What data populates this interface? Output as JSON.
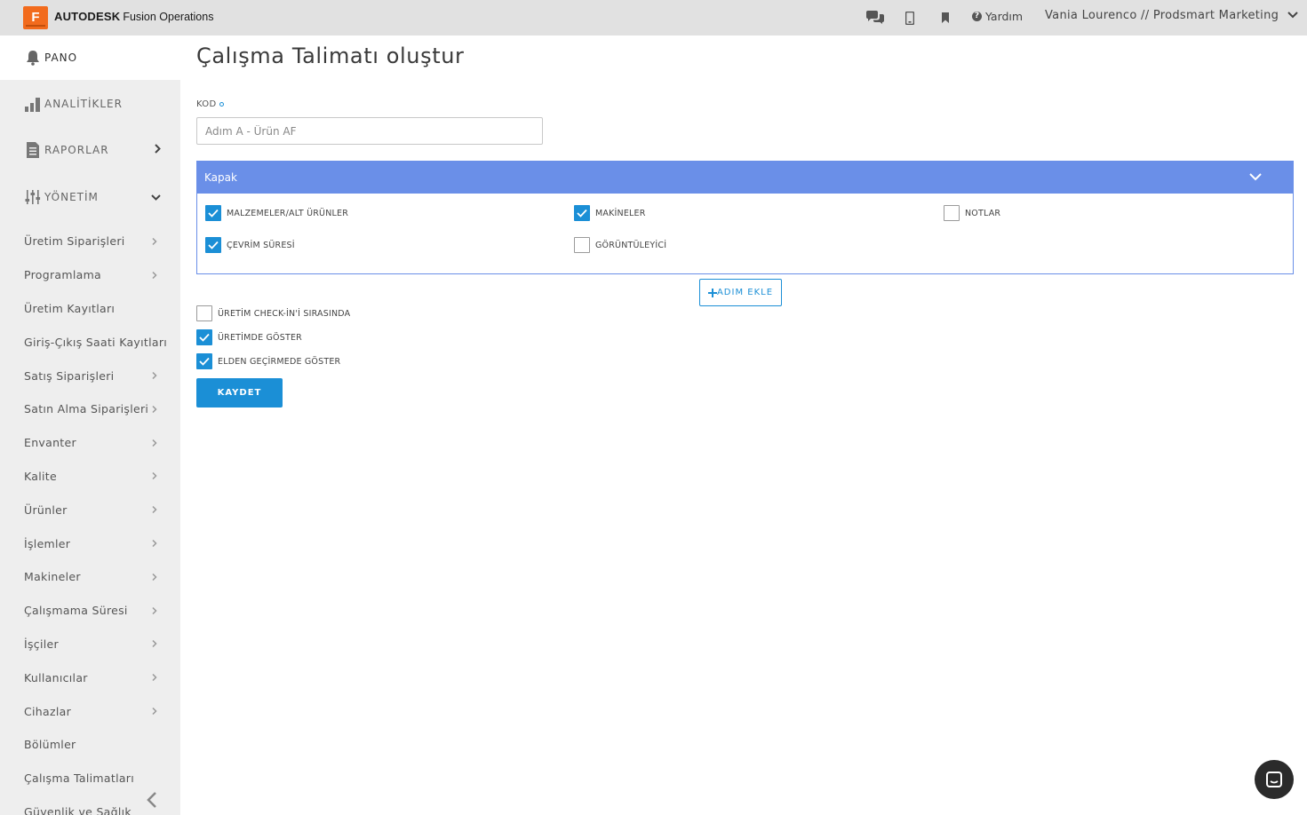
{
  "topbar": {
    "logo_letter": "F",
    "brand_company": "AUTODESK",
    "brand_product": "Fusion Operations",
    "icons": [
      "chat-icon",
      "mobile-icon",
      "bookmark-icon",
      "help-icon"
    ],
    "help_label": "Yardım",
    "user_label": "Vania Lourenco // Prodsmart Marketing"
  },
  "sidebar": {
    "top_items": [
      {
        "label": "PANO",
        "icon": "bell-icon",
        "active": true
      },
      {
        "label": "ANALİTİKLER",
        "icon": "bar-chart-icon"
      },
      {
        "label": "RAPORLAR",
        "icon": "report-icon",
        "chevron": "right"
      },
      {
        "label": "YÖNETİM",
        "icon": "sliders-icon",
        "chevron": "down"
      }
    ],
    "sub_items": [
      {
        "label": "Üretim Siparişleri",
        "chevron": true
      },
      {
        "label": "Programlama",
        "chevron": true
      },
      {
        "label": "Üretim Kayıtları",
        "chevron": false
      },
      {
        "label": "Giriş-Çıkış Saati Kayıtları",
        "chevron": false
      },
      {
        "label": "Satış Siparişleri",
        "chevron": true
      },
      {
        "label": "Satın Alma Siparişleri",
        "chevron": true
      },
      {
        "label": "Envanter",
        "chevron": true
      },
      {
        "label": "Kalite",
        "chevron": true
      },
      {
        "label": "Ürünler",
        "chevron": true
      },
      {
        "label": "İşlemler",
        "chevron": true
      },
      {
        "label": "Makineler",
        "chevron": true
      },
      {
        "label": "Çalışmama Süresi",
        "chevron": true
      },
      {
        "label": "İşçiler",
        "chevron": true
      },
      {
        "label": "Kullanıcılar",
        "chevron": true
      },
      {
        "label": "Cihazlar",
        "chevron": true
      },
      {
        "label": "Bölümler",
        "chevron": false
      },
      {
        "label": "Çalışma Talimatları",
        "chevron": false
      },
      {
        "label": "Güvenlik ve Sağlık",
        "chevron": false
      }
    ]
  },
  "main": {
    "title": "Çalışma Talimatı oluştur",
    "kod_label": "KOD",
    "kod_placeholder": "Adım A - Ürün AF",
    "kod_value": "",
    "panel": {
      "title": "Kapak",
      "options": [
        {
          "label": "MALZEMELER/ALT ÜRÜNLER",
          "checked": true
        },
        {
          "label": "MAKİNELER",
          "checked": true
        },
        {
          "label": "NOTLAR",
          "checked": false
        },
        {
          "label": "ÇEVRİM SÜRESİ",
          "checked": true
        },
        {
          "label": "GÖRÜNTÜLEYİCİ",
          "checked": false
        }
      ]
    },
    "add_step_label": "ADIM EKLE",
    "settings": [
      {
        "label": "ÜRETİM CHECK-İN'İ SIRASINDA",
        "checked": false
      },
      {
        "label": "ÜRETİMDE GÖSTER",
        "checked": true
      },
      {
        "label": "ELDEN GEÇİRMEDE GÖSTER",
        "checked": true
      }
    ],
    "save_label": "KAYDET"
  },
  "colors": {
    "primary": "#1b8fd6",
    "panel_header": "#6a8fe8",
    "topbar": "#e1e1e1",
    "sidebar": "#eeeeee",
    "logo_orange": "#f26b1d"
  }
}
